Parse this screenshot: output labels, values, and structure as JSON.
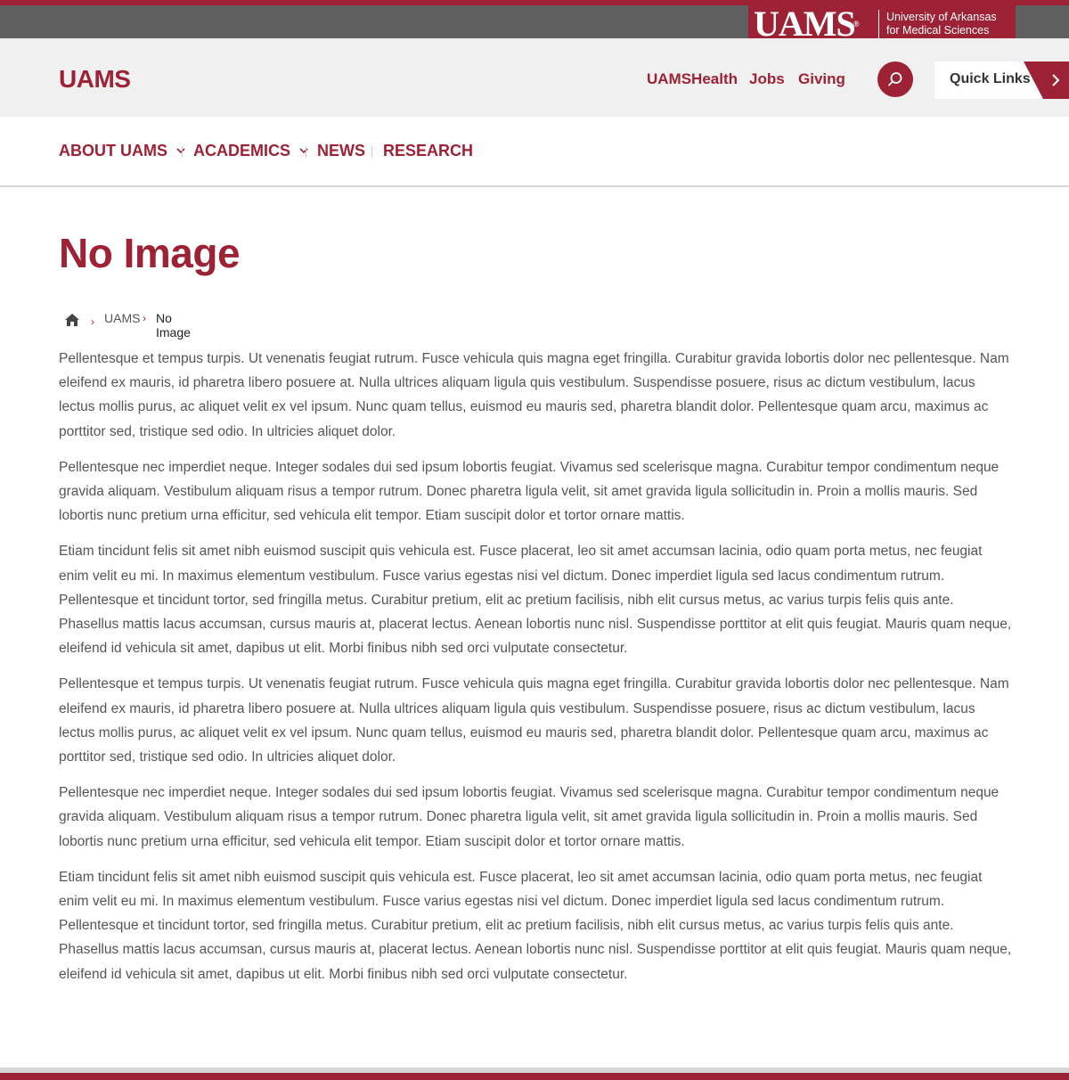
{
  "brand": {
    "wordmark": "UAMS",
    "reg": "®",
    "name_line1": "University of Arkansas",
    "name_line2": "for Medical Sciences"
  },
  "header": {
    "site_title": "UAMS",
    "links": [
      "UAMSHealth",
      "Jobs",
      "Giving"
    ],
    "quick_links_label": "Quick Links"
  },
  "nav": {
    "items": [
      "ABOUT UAMS",
      "ACADEMICS",
      "NEWS",
      "RESEARCH"
    ]
  },
  "page": {
    "title": "No Image"
  },
  "breadcrumb": {
    "items": [
      "UAMS",
      "No Image"
    ],
    "separator": "›"
  },
  "content": {
    "paragraphs": [
      "Pellentesque et tempus turpis. Ut venenatis feugiat rutrum. Fusce vehicula quis magna eget fringilla. Curabitur gravida lobortis dolor nec pellentesque. Nam eleifend ex mauris, id pharetra libero posuere at. Nulla ultrices aliquam ligula quis vestibulum. Suspendisse posuere, risus ac dictum vestibulum, lacus lectus mollis purus, ac aliquet velit ex vel ipsum. Nunc quam tellus, euismod eu mauris sed, pharetra blandit dolor. Pellentesque quam arcu, maximus ac porttitor sed, tristique sed odio. In ultricies aliquet dolor.",
      "Pellentesque nec imperdiet neque. Integer sodales dui sed ipsum lobortis feugiat. Vivamus sed scelerisque magna. Curabitur tempor condimentum neque gravida aliquam. Vestibulum aliquam risus a tempor rutrum. Donec pharetra ligula velit, sit amet gravida ligula sollicitudin in. Proin a mollis mauris. Sed lobortis nunc pretium urna efficitur, sed vehicula elit tempor. Etiam suscipit dolor et tortor ornare mattis.",
      "Etiam tincidunt felis sit amet nibh euismod suscipit quis vehicula est. Fusce placerat, leo sit amet accumsan lacinia, odio quam porta metus, nec feugiat enim velit eu mi. In maximus elementum vestibulum. Fusce varius egestas nisi vel dictum. Donec imperdiet ligula sed lacus condimentum rutrum. Pellentesque et tincidunt tortor, sed fringilla metus. Curabitur pretium, elit ac pretium facilisis, nibh elit cursus metus, ac varius turpis felis quis ante. Phasellus mattis lacus accumsan, cursus mauris at, placerat lectus. Aenean lobortis nunc nisl. Suspendisse porttitor at elit quis feugiat. Mauris quam neque, eleifend id vehicula sit amet, dapibus ut elit. Morbi finibus nibh sed orci vulputate consectetur.",
      "Pellentesque et tempus turpis. Ut venenatis feugiat rutrum. Fusce vehicula quis magna eget fringilla. Curabitur gravida lobortis dolor nec pellentesque. Nam eleifend ex mauris, id pharetra libero posuere at. Nulla ultrices aliquam ligula quis vestibulum. Suspendisse posuere, risus ac dictum vestibulum, lacus lectus mollis purus, ac aliquet velit ex vel ipsum. Nunc quam tellus, euismod eu mauris sed, pharetra blandit dolor. Pellentesque quam arcu, maximus ac porttitor sed, tristique sed odio. In ultricies aliquet dolor.",
      "Pellentesque nec imperdiet neque. Integer sodales dui sed ipsum lobortis feugiat. Vivamus sed scelerisque magna. Curabitur tempor condimentum neque gravida aliquam. Vestibulum aliquam risus a tempor rutrum. Donec pharetra ligula velit, sit amet gravida ligula sollicitudin in. Proin a mollis mauris. Sed lobortis nunc pretium urna efficitur, sed vehicula elit tempor. Etiam suscipit dolor et tortor ornare mattis.",
      "Etiam tincidunt felis sit amet nibh euismod suscipit quis vehicula est. Fusce placerat, leo sit amet accumsan lacinia, odio quam porta metus, nec feugiat enim velit eu mi. In maximus elementum vestibulum. Fusce varius egestas nisi vel dictum. Donec imperdiet ligula sed lacus condimentum rutrum. Pellentesque et tincidunt tortor, sed fringilla metus. Curabitur pretium, elit ac pretium facilisis, nibh elit cursus metus, ac varius turpis felis quis ante. Phasellus mattis lacus accumsan, cursus mauris at, placerat lectus. Aenean lobortis nunc nisl. Suspendisse porttitor at elit quis feugiat. Mauris quam neque, eleifend id vehicula sit amet, dapibus ut elit. Morbi finibus nibh sed orci vulputate consectetur."
    ]
  },
  "icons": {
    "search": "search-icon",
    "quick_links_arrow": "chevron-right-icon",
    "nav_dropdown": "chevron-down-icon",
    "breadcrumb_home": "home-icon"
  },
  "colors": {
    "brand_red": "#9d2235",
    "utility_gray": "#5f5f5f",
    "header_bg": "#f0f0f0",
    "body_text": "#555555"
  }
}
